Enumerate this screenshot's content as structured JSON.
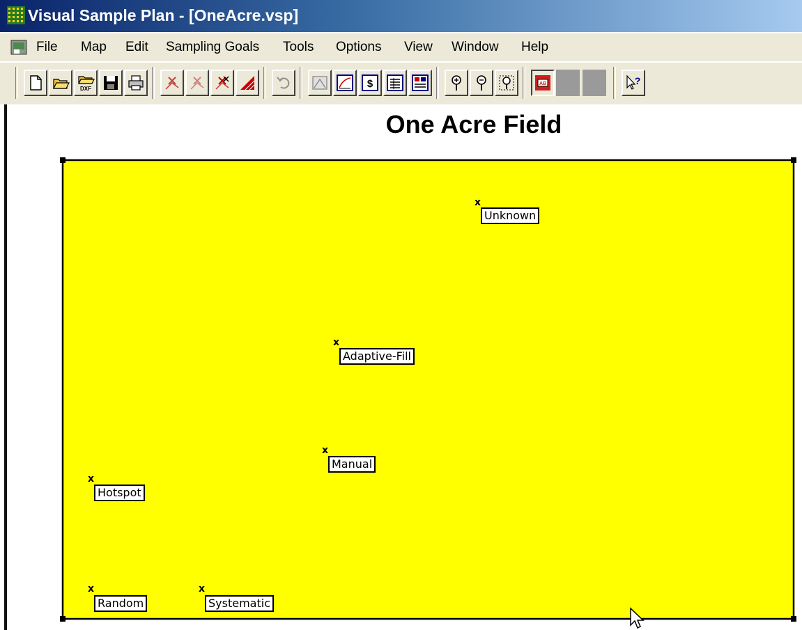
{
  "window": {
    "title": "Visual Sample Plan - [OneAcre.vsp]"
  },
  "menu": {
    "items": [
      "File",
      "Map",
      "Edit",
      "Sampling Goals",
      "Tools",
      "Options",
      "View",
      "Window",
      "Help"
    ]
  },
  "toolbar": {
    "buttons": [
      {
        "icon": "new-document-icon"
      },
      {
        "icon": "open-folder-icon"
      },
      {
        "icon": "open-dxf-icon",
        "label": "DXF"
      },
      {
        "icon": "save-disk-icon"
      },
      {
        "icon": "printer-icon"
      },
      {
        "icon": "add-sample-icon"
      },
      {
        "icon": "move-sample-icon"
      },
      {
        "icon": "delete-sample-icon"
      },
      {
        "icon": "triangle-area-icon"
      },
      {
        "icon": "undo-icon"
      },
      {
        "icon": "map-view-icon"
      },
      {
        "icon": "graph-view-icon"
      },
      {
        "icon": "cost-icon",
        "label": "$"
      },
      {
        "icon": "report-icon"
      },
      {
        "icon": "coordinates-icon"
      },
      {
        "icon": "zoom-in-icon"
      },
      {
        "icon": "zoom-out-icon"
      },
      {
        "icon": "zoom-extent-icon"
      },
      {
        "icon": "sample-labels-toggle-icon",
        "label": "AB"
      },
      {
        "icon": "blank-button-icon"
      },
      {
        "icon": "blank-button-icon"
      },
      {
        "icon": "context-help-icon"
      }
    ]
  },
  "map": {
    "title": "One Acre Field",
    "field_color": "#ffff00",
    "samples": [
      {
        "label": "Unknown",
        "marker": "x"
      },
      {
        "label": "Adaptive-Fill",
        "marker": "x"
      },
      {
        "label": "Manual",
        "marker": "x"
      },
      {
        "label": "Hotspot",
        "marker": "x"
      },
      {
        "label": "Random",
        "marker": "x"
      },
      {
        "label": "Systematic",
        "marker": "x"
      }
    ]
  }
}
